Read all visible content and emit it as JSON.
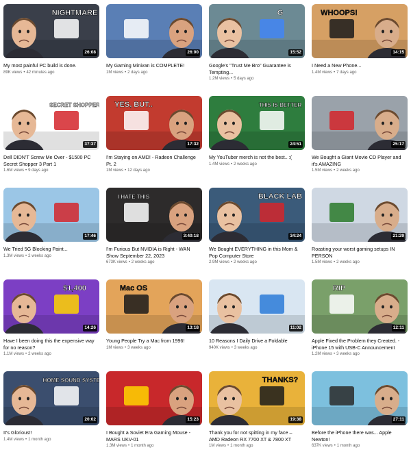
{
  "videos": [
    {
      "title": "My most painful PC build is done.",
      "views": "89K views",
      "age": "42 minutes ago",
      "duration": "26:08",
      "overlay": "NIGHTMARE",
      "bg": "#3a3f4a",
      "accent": "#ffffff"
    },
    {
      "title": "My Gaming Minivan is COMPLETE!",
      "views": "1M views",
      "age": "2 days ago",
      "duration": "26:00",
      "overlay": "",
      "bg": "#5a7fb5",
      "accent": "#ffffff"
    },
    {
      "title": "Google's \"Trust Me Bro\" Guarantee is Tempting...",
      "views": "1.2M views",
      "age": "5 days ago",
      "duration": "15:52",
      "overlay": "G",
      "bg": "#6c8a94",
      "accent": "#4285f4"
    },
    {
      "title": "I Need a New Phone...",
      "views": "1.4M views",
      "age": "7 days ago",
      "duration": "14:15",
      "overlay": "WHOOPS!",
      "bg": "#d6a064",
      "accent": "#1b1b1b"
    },
    {
      "title": "Dell DIDN'T Screw Me Over - $1500 PC Secret Shopper 3 Part 1",
      "views": "1.6M views",
      "age": "9 days ago",
      "duration": "37:37",
      "overlay": "SECRET SHOPPER",
      "bg": "#ffffff",
      "accent": "#d3262c"
    },
    {
      "title": "I'm Staying on AMD! - Radeon Challenge Pt. 2",
      "views": "1M views",
      "age": "12 days ago",
      "duration": "17:32",
      "overlay": "YES, BUT..",
      "bg": "#c23b2f",
      "accent": "#ffffff"
    },
    {
      "title": "My YouTuber merch is not the best.. :(",
      "views": "1.4M views",
      "age": "2 weeks ago",
      "duration": "24:51",
      "overlay": "THIS IS BETTER",
      "bg": "#2e7d3e",
      "accent": "#ffffff"
    },
    {
      "title": "We Bought a Giant Movie CD Player and it's AMAZING",
      "views": "1.5M views",
      "age": "2 weeks ago",
      "duration": "25:17",
      "overlay": "",
      "bg": "#9aa2aa",
      "accent": "#d3262c"
    },
    {
      "title": "We Tried 5G Blocking Paint...",
      "views": "1.3M views",
      "age": "2 weeks ago",
      "duration": "17:46",
      "overlay": "",
      "bg": "#9bc6e6",
      "accent": "#d3262c"
    },
    {
      "title": "I'm Furious But NVIDIA is Right - WAN Show September 22, 2023",
      "views": "673K views",
      "age": "2 weeks ago",
      "duration": "3:40:18",
      "overlay": "I HATE THIS",
      "bg": "#2d2b2b",
      "accent": "#ffffff"
    },
    {
      "title": "We Bought EVERYTHING in this Mom & Pop Computer Store",
      "views": "2.9M views",
      "age": "2 weeks ago",
      "duration": "34:24",
      "overlay": "BLACK LAB",
      "bg": "#3b5b7a",
      "accent": "#d3262c"
    },
    {
      "title": "Roasting your worst gaming setups IN PERSON",
      "views": "1.5M views",
      "age": "2 weeks ago",
      "duration": "21:29",
      "overlay": "",
      "bg": "#cfd8e3",
      "accent": "#2a7a2a"
    },
    {
      "title": "Have I been doing this the expensive way for no reason?",
      "views": "1.1M views",
      "age": "2 weeks ago",
      "duration": "14:26",
      "overlay": "$1,400",
      "bg": "#7c3fc4",
      "accent": "#ffd400"
    },
    {
      "title": "Young People Try a Mac from 1996!",
      "views": "1M views",
      "age": "3 weeks ago",
      "duration": "13:18",
      "overlay": "Mac OS",
      "bg": "#e3a45a",
      "accent": "#1b1b1b"
    },
    {
      "title": "10 Reasons I Daily Drive a Foldable",
      "views": "940K views",
      "age": "3 weeks ago",
      "duration": "11:02",
      "overlay": "",
      "bg": "#d9e6f2",
      "accent": "#2a7ad8"
    },
    {
      "title": "Apple Fixed the Problem they Created. - iPhone 15 with USB-C Announcement",
      "views": "1.2M views",
      "age": "3 weeks ago",
      "duration": "12:11",
      "overlay": "RIP",
      "bg": "#7aa06a",
      "accent": "#ffffff"
    },
    {
      "title": "It's Glorious!!",
      "views": "1.4M views",
      "age": "1 month ago",
      "duration": "20:02",
      "overlay": "HOME SOUND SYSTEM!",
      "bg": "#3b4e6e",
      "accent": "#ffffff"
    },
    {
      "title": "I Bought a Soviet Era Gaming Mouse - MARS UKV-01",
      "views": "1.3M views",
      "age": "1 month ago",
      "duration": "15:23",
      "overlay": "",
      "bg": "#c8282b",
      "accent": "#ffd400"
    },
    {
      "title": "Thank you for not spitting in my face – AMD Radeon RX 7700 XT & 7800 XT Review",
      "views": "1M views",
      "age": "1 month ago",
      "duration": "19:38",
      "overlay": "THANKS?",
      "bg": "#e9b23a",
      "accent": "#1b1b1b"
    },
    {
      "title": "Before the iPhone there was... Apple Newton!",
      "views": "637K views",
      "age": "1 month ago",
      "duration": "27:11",
      "overlay": "",
      "bg": "#7dc0de",
      "accent": "#2a2a2a"
    }
  ]
}
